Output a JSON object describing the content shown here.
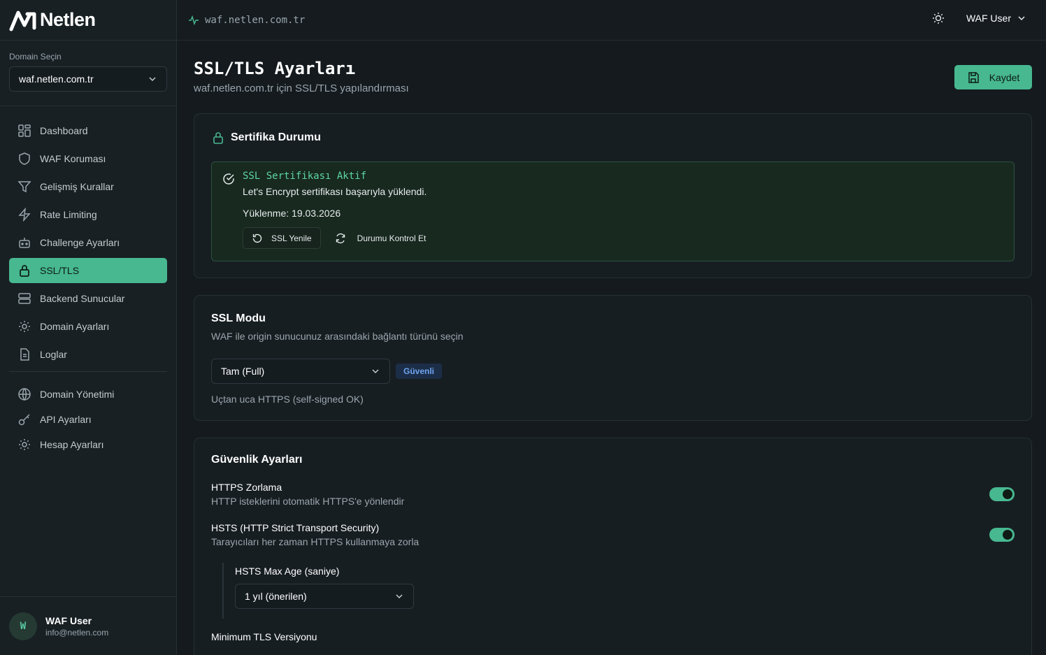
{
  "brand": {
    "name": "Netlen"
  },
  "sidebar": {
    "domain_label": "Domain Seçin",
    "domain_value": "waf.netlen.com.tr",
    "items": [
      {
        "label": "Dashboard",
        "icon": "dashboard-icon"
      },
      {
        "label": "WAF Koruması",
        "icon": "shield-icon"
      },
      {
        "label": "Gelişmiş Kurallar",
        "icon": "filter-icon"
      },
      {
        "label": "Rate Limiting",
        "icon": "zap-icon"
      },
      {
        "label": "Challenge Ayarları",
        "icon": "bot-icon"
      },
      {
        "label": "SSL/TLS",
        "icon": "lock-icon",
        "active": true
      },
      {
        "label": "Backend Sunucular",
        "icon": "server-icon"
      },
      {
        "label": "Domain Ayarları",
        "icon": "gear-icon"
      },
      {
        "label": "Loglar",
        "icon": "file-icon"
      }
    ],
    "items2": [
      {
        "label": "Domain Yönetimi",
        "icon": "globe-icon"
      },
      {
        "label": "API Ayarları",
        "icon": "key-icon"
      },
      {
        "label": "Hesap Ayarları",
        "icon": "gear-icon"
      }
    ],
    "user": {
      "initial": "W",
      "name": "WAF User",
      "email": "info@netlen.com"
    }
  },
  "topbar": {
    "site": "waf.netlen.com.tr",
    "user": "WAF User"
  },
  "page": {
    "title": "SSL/TLS Ayarları",
    "subtitle": "waf.netlen.com.tr için SSL/TLS yapılandırması",
    "save_label": "Kaydet"
  },
  "cert": {
    "title": "Sertifika Durumu",
    "status_title": "SSL Sertifikası Aktif",
    "status_desc": "Let's Encrypt sertifikası başarıyla yüklendi.",
    "date": "Yüklenme: 19.03.2026",
    "renew_label": "SSL Yenile",
    "check_label": "Durumu Kontrol Et"
  },
  "mode": {
    "title": "SSL Modu",
    "subtitle": "WAF ile origin sunucunuz arasındaki bağlantı türünü seçin",
    "selected": "Tam (Full)",
    "badge": "Güvenli",
    "note": "Uçtan uca HTTPS (self-signed OK)"
  },
  "security": {
    "title": "Güvenlik Ayarları",
    "https": {
      "title": "HTTPS Zorlama",
      "desc": "HTTP isteklerini otomatik HTTPS'e yönlendir",
      "enabled": true
    },
    "hsts": {
      "title": "HSTS (HTTP Strict Transport Security)",
      "desc": "Tarayıcıları her zaman HTTPS kullanmaya zorla",
      "enabled": true
    },
    "hsts_max_age_label": "HSTS Max Age (saniye)",
    "hsts_max_age_value": "1 yıl (önerilen)",
    "min_tls_label": "Minimum TLS Versiyonu"
  },
  "colors": {
    "accent": "#47b890",
    "badge_blue": "#6ea4f0",
    "success_text": "#5dd6a3"
  }
}
